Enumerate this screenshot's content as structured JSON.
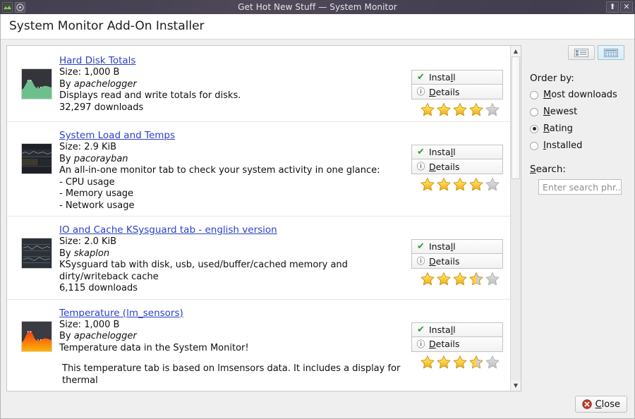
{
  "window": {
    "title": "Get Hot New Stuff — System Monitor",
    "icons": [
      "system-monitor-icon",
      "disc-icon"
    ],
    "buttons": [
      {
        "name": "shade-button",
        "glyph": "⬆"
      },
      {
        "name": "close-button",
        "glyph": "✕"
      }
    ]
  },
  "header": {
    "title": "System Monitor Add-On Installer"
  },
  "list": {
    "entries": [
      {
        "title": "Hard Disk Totals",
        "size": "Size: 1,000 B",
        "author_prefix": "By ",
        "author": "apachelogger",
        "description": "Displays read and write totals for disks.",
        "downloads": "32,297 downloads",
        "extra": "",
        "rating": 4,
        "install_label": "Install",
        "details_label": "Details",
        "thumb": "green-graph-thumbnail"
      },
      {
        "title": "System Load and Temps",
        "size": "Size: 2.9 KiB",
        "author_prefix": "By ",
        "author": "pacorayban",
        "description": "An all-in-one monitor tab to check your system activity in one glance:",
        "bullets": [
          " - CPU usage",
          " - Memory usage",
          " - Network usage"
        ],
        "downloads": "",
        "extra": "",
        "rating": 4,
        "install_label": "Install",
        "details_label": "Details",
        "thumb": "dark-graph-thumbnail"
      },
      {
        "title": "IO and Cache KSysguard tab - english version",
        "size": "Size: 2.0 KiB",
        "author_prefix": "By ",
        "author": "skaplon",
        "description": "KSysguard tab with disk, usb, used/buffer/cached memory and dirty/writeback cache",
        "downloads": "6,115 downloads",
        "extra": "",
        "rating": 3.5,
        "install_label": "Install",
        "details_label": "Details",
        "thumb": "dark-chart-thumbnail"
      },
      {
        "title": "Temperature (lm_sensors)",
        "size": "Size: 1,000 B",
        "author_prefix": "By ",
        "author": "apachelogger",
        "description": "Temperature data in the System Monitor!",
        "downloads": "",
        "extra": "This temperature tab is based on lmsensors data. It includes a display for thermal",
        "rating": 3.5,
        "install_label": "Install",
        "details_label": "Details",
        "thumb": "orange-graph-thumbnail"
      }
    ]
  },
  "scrollbar": {
    "up_glyph": "▲",
    "down_glyph": "▼"
  },
  "sidebar": {
    "view_buttons": [
      {
        "name": "list-view-button",
        "active": false
      },
      {
        "name": "detail-view-button",
        "active": true
      }
    ],
    "order_by_label": "Order by:",
    "options": [
      {
        "label": "Most downloads",
        "accel": "M",
        "rest": "ost downloads",
        "selected": false
      },
      {
        "label": "Newest",
        "accel": "N",
        "rest": "ewest",
        "selected": false
      },
      {
        "label": "Rating",
        "accel": "R",
        "rest": "ating",
        "selected": true
      },
      {
        "label": "Installed",
        "accel": "I",
        "rest": "nstalled",
        "selected": false
      }
    ],
    "search_label": "Search:",
    "search_accel": "S",
    "search_rest": "earch:",
    "search_value": "",
    "search_placeholder": "Enter search phr..."
  },
  "footer": {
    "close_label": "Close"
  },
  "colors": {
    "accent_link": "#2b41c8",
    "star_gold": "#f5c343",
    "star_empty": "#c9c9c9",
    "install_check": "#2fa02f",
    "close_red": "#c0392b",
    "titlebar": "#3e3a4a"
  }
}
